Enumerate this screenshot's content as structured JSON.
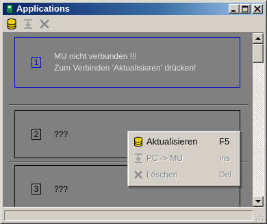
{
  "window": {
    "title": "Applications",
    "controls": {
      "minimize": "minimize",
      "maximize": "maximize",
      "close": "close"
    }
  },
  "toolbar": {
    "items": [
      {
        "name": "refresh",
        "icon": "database-icon"
      },
      {
        "name": "pc-to-mu",
        "icon": "download-icon"
      },
      {
        "name": "delete",
        "icon": "cross-icon"
      }
    ]
  },
  "slots": [
    {
      "number": "1",
      "line1": "MU nicht verbunden !!!",
      "line2": "Zum Verbinden 'Aktualisieren' drücken!",
      "selected": true
    },
    {
      "number": "2",
      "line1": "???"
    },
    {
      "number": "3",
      "line1": "???"
    }
  ],
  "context_menu": {
    "items": [
      {
        "label": "Aktualisieren",
        "shortcut": "F5",
        "icon": "database-icon",
        "enabled": true
      },
      {
        "label": "PC -> MU",
        "shortcut": "Ins",
        "icon": "download-icon",
        "enabled": false
      },
      {
        "label": "Löschen",
        "shortcut": "Del",
        "icon": "cross-icon",
        "enabled": false
      }
    ]
  },
  "status": {
    "text": ""
  },
  "colors": {
    "title_active": "#0a246a",
    "title_gradient_end": "#a6caf0",
    "face": "#d4d0c8",
    "content_bg": "#808080",
    "selection_border": "#0000cc",
    "icon_yellow": "#f0d000"
  }
}
